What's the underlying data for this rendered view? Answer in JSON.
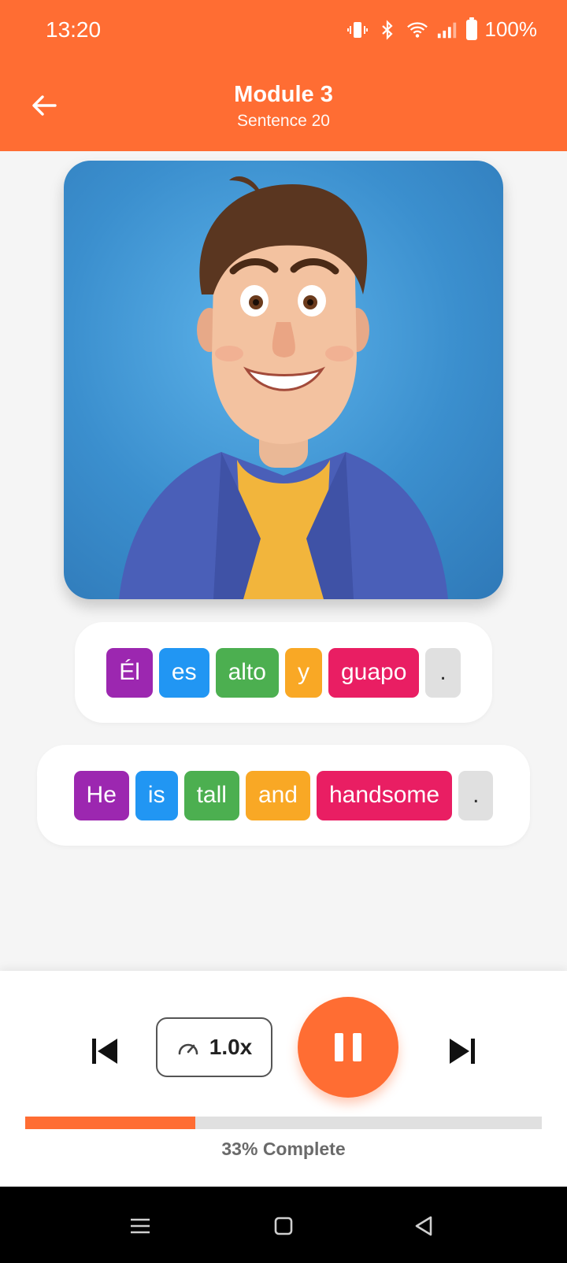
{
  "status_bar": {
    "time": "13:20",
    "battery_text": "100%",
    "icons": [
      "vibrate-icon",
      "bluetooth-icon",
      "wifi-icon",
      "signal-icon",
      "battery-icon"
    ]
  },
  "header": {
    "title": "Module 3",
    "subtitle": "Sentence 20",
    "back_icon": "arrow-left-icon"
  },
  "illustration": {
    "alt": "cartoon-man"
  },
  "sentence_spanish": [
    {
      "text": "Él",
      "color": "#9c27b0"
    },
    {
      "text": "es",
      "color": "#2196f3"
    },
    {
      "text": "alto",
      "color": "#4caf50"
    },
    {
      "text": "y",
      "color": "#f9a825"
    },
    {
      "text": "guapo",
      "color": "#e91e63"
    },
    {
      "text": ".",
      "color": "#e0e0e0"
    }
  ],
  "sentence_english": [
    {
      "text": "He",
      "color": "#9c27b0"
    },
    {
      "text": "is",
      "color": "#2196f3"
    },
    {
      "text": "tall",
      "color": "#4caf50"
    },
    {
      "text": "and",
      "color": "#f9a825"
    },
    {
      "text": "handsome",
      "color": "#e91e63"
    },
    {
      "text": ".",
      "color": "#e0e0e0"
    }
  ],
  "player": {
    "speed_label": "1.0x",
    "play_state": "pause",
    "progress_fraction": 0.33,
    "progress_text": "33% Complete"
  },
  "colors": {
    "accent": "#ff6d33"
  }
}
